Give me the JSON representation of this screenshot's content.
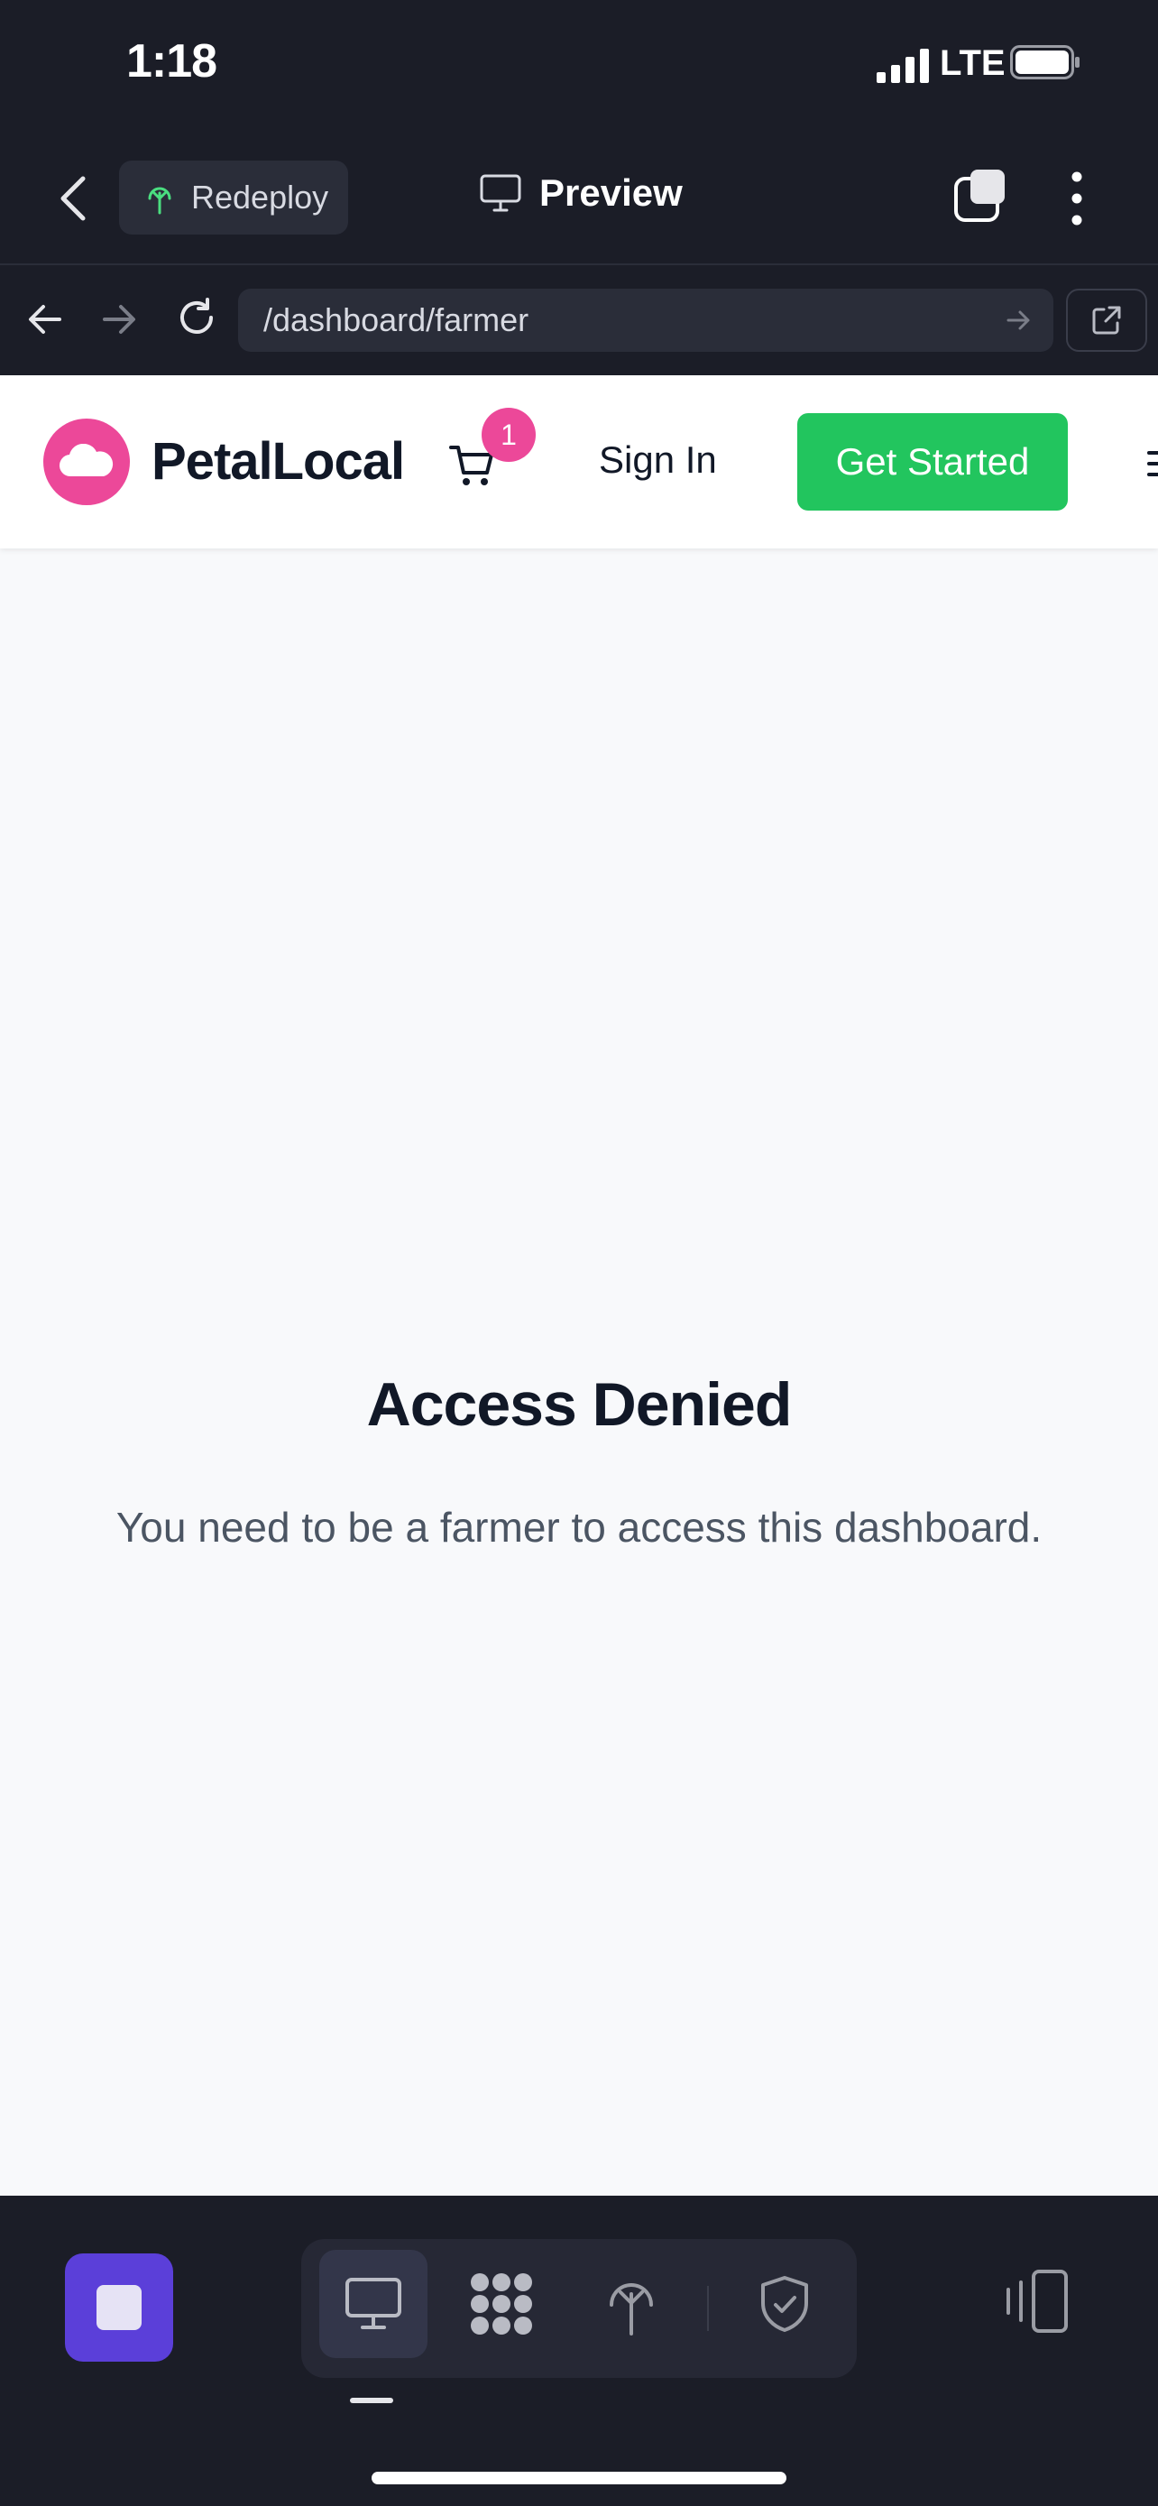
{
  "status_bar": {
    "time": "1:18",
    "network": "LTE"
  },
  "toolbar": {
    "redeploy_label": "Redeploy",
    "title": "Preview"
  },
  "browser": {
    "url": "/dashboard/farmer"
  },
  "site": {
    "brand": "PetalLocal",
    "cart_count": "1",
    "sign_in": "Sign In",
    "get_started": "Get Started",
    "brand_color": "#ec4899",
    "cta_color": "#22c55e"
  },
  "content": {
    "title": "Access Denied",
    "message": "You need to be a farmer to access this dashboard."
  },
  "bottom_bar": {
    "accent": "#5b3fd9",
    "modes": [
      "monitor-icon",
      "dots-grid-icon",
      "deploy-tree-icon",
      "shield-check-icon"
    ]
  }
}
